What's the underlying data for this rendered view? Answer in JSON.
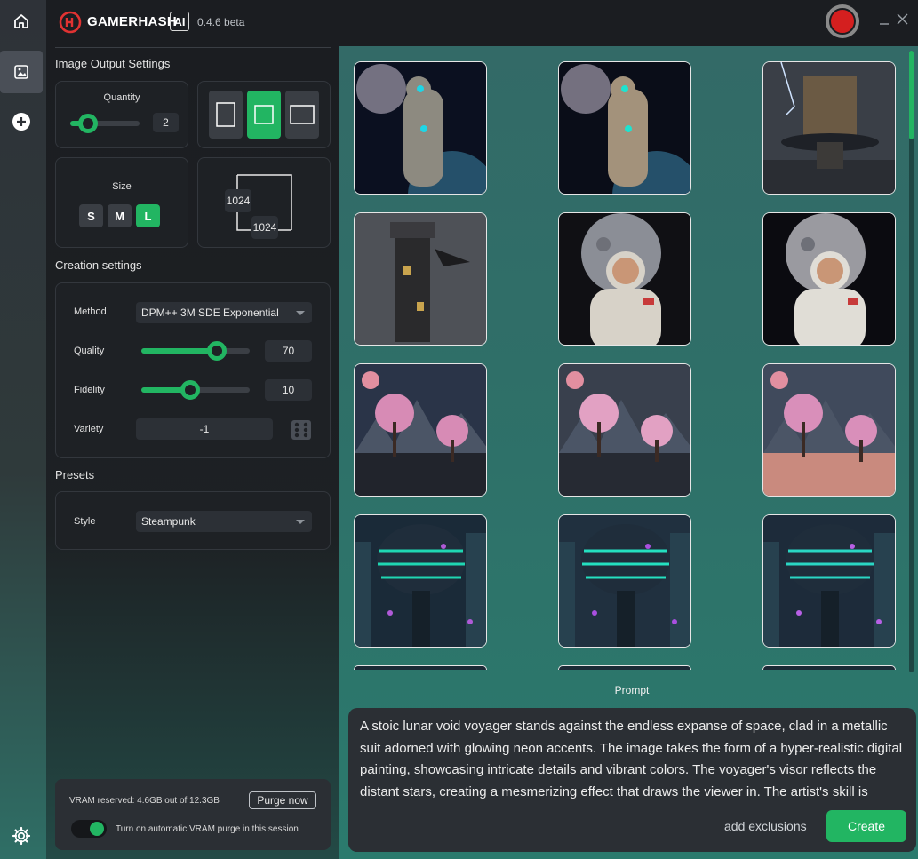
{
  "app": {
    "brand": "GAMERHASH",
    "brand_ai": "AI",
    "version": "0.4.6 beta",
    "window_controls": [
      "minimize-icon",
      "close-icon"
    ]
  },
  "rail": {
    "items": [
      "home-icon",
      "image-icon",
      "add-icon"
    ],
    "active": "image-icon",
    "footer": "settings-gear-icon"
  },
  "output_settings": {
    "title": "Image Output Settings",
    "quantity_label": "Quantity",
    "quantity_value": "2",
    "quantity_fraction": 0.25,
    "aspect_options": [
      "portrait",
      "square",
      "landscape"
    ],
    "aspect_selected": "square",
    "size_label": "Size",
    "sizes": [
      "S",
      "M",
      "L"
    ],
    "size_selected": "L",
    "width": "1024",
    "height": "1024"
  },
  "creation_settings": {
    "title": "Creation settings",
    "method_label": "Method",
    "method_value": "DPM++ 3M SDE Exponential",
    "quality_label": "Quality",
    "quality_value": "70",
    "quality_fraction": 0.7,
    "fidelity_label": "Fidelity",
    "fidelity_value": "10",
    "fidelity_fraction": 0.45,
    "variety_label": "Variety",
    "variety_value": "-1"
  },
  "presets": {
    "title": "Presets",
    "style_label": "Style",
    "style_value": "Steampunk"
  },
  "vram": {
    "reserved_text": "VRAM reserved: 4.6GB out of 12.3GB",
    "purge_label": "Purge now",
    "auto_purge_label": "Turn on automatic VRAM purge in this session",
    "auto_purge_on": true
  },
  "gallery": {
    "scroll_fraction": 0.0,
    "images": [
      {
        "theme": "robot-space",
        "colors": [
          "#0b1020",
          "#8d8a80",
          "#1ed6e6"
        ]
      },
      {
        "theme": "robot-space",
        "colors": [
          "#0a0d18",
          "#a3927b",
          "#1ee3d0"
        ]
      },
      {
        "theme": "steampunk-city",
        "colors": [
          "#3a3f47",
          "#6b5a44",
          "#1e2127"
        ]
      },
      {
        "theme": "dark-tower",
        "colors": [
          "#4e5157",
          "#2a2a2c",
          "#c9a44e"
        ]
      },
      {
        "theme": "astronaut-moon",
        "colors": [
          "#101014",
          "#d7d2c8",
          "#8b8e96"
        ]
      },
      {
        "theme": "astronaut-moon",
        "colors": [
          "#0b0b10",
          "#e0ddd6",
          "#9a9aa0"
        ]
      },
      {
        "theme": "cherry-blossom-lake",
        "colors": [
          "#2a3448",
          "#d78bb5",
          "#21242c"
        ]
      },
      {
        "theme": "cherry-blossom-lake",
        "colors": [
          "#39404d",
          "#e2a1c3",
          "#262a33"
        ]
      },
      {
        "theme": "cherry-blossom-lake",
        "colors": [
          "#404a5c",
          "#d98fba",
          "#c98a7e"
        ]
      },
      {
        "theme": "cyberpunk-tower",
        "colors": [
          "#1a2a38",
          "#1fd6b2",
          "#b05ad8"
        ]
      },
      {
        "theme": "cyberpunk-tower",
        "colors": [
          "#20303f",
          "#24e0c0",
          "#a94fe0"
        ]
      },
      {
        "theme": "cyberpunk-tower",
        "colors": [
          "#1d2b3a",
          "#2ad6c4",
          "#b860e6"
        ]
      }
    ]
  },
  "prompt": {
    "label": "Prompt",
    "text": "A stoic lunar void voyager stands against the endless expanse of space, clad in a metallic suit adorned with glowing neon accents. The image takes the form of a hyper-realistic digital painting, showcasing intricate details and vibrant colors. The voyager's visor reflects the distant stars, creating a mesmerizing effect that draws the viewer in. The artist's skill is evident in the meticulous rendering of the",
    "exclusions_label": "add exclusions",
    "create_label": "Create"
  },
  "colors": {
    "accent": "#22b562",
    "panel": "#1b1d21",
    "gallery_bg": "#2f6f68"
  }
}
